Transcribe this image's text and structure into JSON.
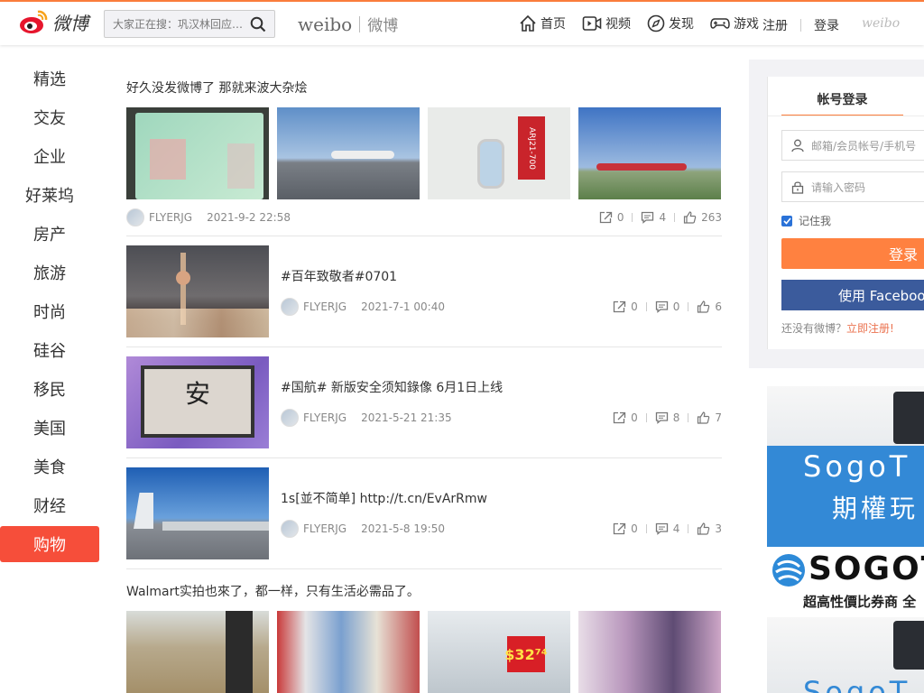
{
  "header": {
    "logo_text": "微博",
    "search_placeholder": "大家正在搜：巩汉林回应…",
    "brand_en": "weibo",
    "brand_cn": "微博",
    "nav": [
      {
        "label": "首页",
        "icon": "home-icon"
      },
      {
        "label": "视频",
        "icon": "video-icon"
      },
      {
        "label": "发现",
        "icon": "compass-icon"
      },
      {
        "label": "游戏",
        "icon": "gamepad-icon"
      }
    ],
    "register": "注册",
    "login": "登录",
    "weibo_small": "weibo"
  },
  "leftnav": {
    "items": [
      "精选",
      "交友",
      "企业",
      "好莱坞",
      "房产",
      "旅游",
      "时尚",
      "硅谷",
      "移民",
      "美国",
      "美食",
      "财经",
      "购物"
    ],
    "active": "购物"
  },
  "feed": {
    "post1": {
      "title": "好久没发微博了 那就来波大杂烩",
      "author": "FLYERJG",
      "date": "2021-9-2 22:58",
      "shares": "0",
      "comments": "4",
      "likes": "263"
    },
    "post2": {
      "title": "#百年致敬者#0701",
      "author": "FLYERJG",
      "date": "2021-7-1 00:40",
      "shares": "0",
      "comments": "0",
      "likes": "6"
    },
    "post3": {
      "title": "#国航# 新版安全须知錄像 6月1日上线",
      "author": "FLYERJG",
      "date": "2021-5-21 21:35",
      "shares": "0",
      "comments": "8",
      "likes": "7"
    },
    "post4": {
      "title": "1s[並不简单] http://t.cn/EvArRmw",
      "author": "FLYERJG",
      "date": "2021-5-8 19:50",
      "shares": "0",
      "comments": "4",
      "likes": "3"
    },
    "post5": {
      "title": "Walmart实拍也來了，都一样，只有生活必需品了。"
    },
    "tv_char": "安",
    "plane_tag": "ARJ21-700",
    "price_tag": "$32⁷⁴"
  },
  "login": {
    "tab": "帐号登录",
    "user_placeholder": "邮箱/会员帐号/手机号",
    "pass_placeholder": "请输入密码",
    "remember": "记住我",
    "login_button": "登录",
    "facebook_button": "使用 Facebook",
    "no_account": "还没有微博？",
    "signup_link": "立即注册!"
  },
  "ad": {
    "line1": "SogoT",
    "line2": "期權玩",
    "brand": "SOGOT",
    "tagline": "超高性價比券商 全",
    "bottom": "SogoT"
  },
  "colors": {
    "accent": "#fa7d3c",
    "active_nav": "#f64e3a",
    "facebook": "#3b5b9c"
  }
}
